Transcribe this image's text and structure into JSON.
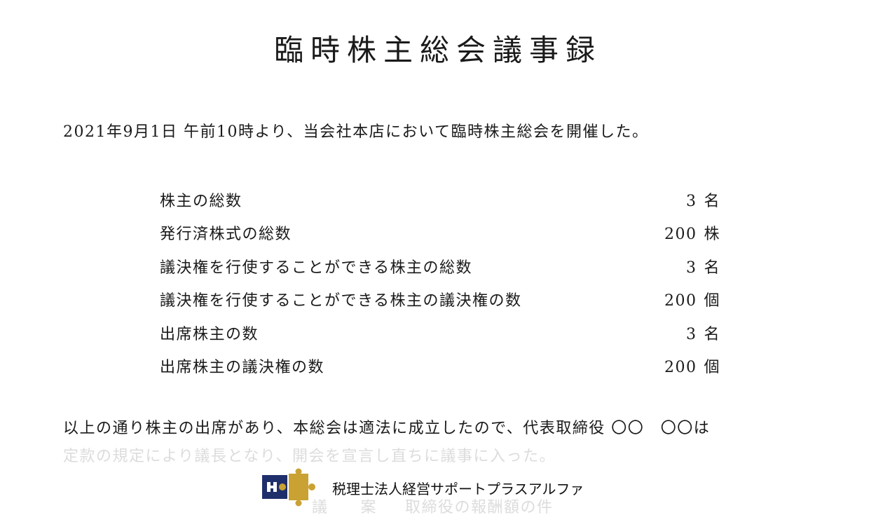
{
  "title": "臨時株主総会議事録",
  "intro": "2021年9月1日 午前10時より、当会社本店において臨時株主総会を開催した。",
  "stats": [
    {
      "label": "株主の総数",
      "value": "3",
      "unit": "名"
    },
    {
      "label": "発行済株式の総数",
      "value": "200",
      "unit": "株"
    },
    {
      "label": "議決権を行使することができる株主の総数",
      "value": "3",
      "unit": "名"
    },
    {
      "label": "議決権を行使することができる株主の議決権の数",
      "value": "200",
      "unit": "個"
    },
    {
      "label": "出席株主の数",
      "value": "3",
      "unit": "名"
    },
    {
      "label": "出席株主の議決権の数",
      "value": "200",
      "unit": "個"
    }
  ],
  "paragraph": {
    "line1": "以上の通り株主の出席があり、本総会は適法に成立したので、代表取締役 〇〇　〇〇は",
    "line2": "定款の規定により議長となり、開会を宣言し直ちに議事に入った。"
  },
  "agenda": {
    "prefix1": "議",
    "prefix2": "案",
    "subject": "取締役の報酬額の件"
  },
  "watermark": {
    "text": "税理士法人経営サポートプラスアルファ",
    "colors": {
      "navy": "#1f2f6b",
      "gold": "#c9a233"
    }
  }
}
